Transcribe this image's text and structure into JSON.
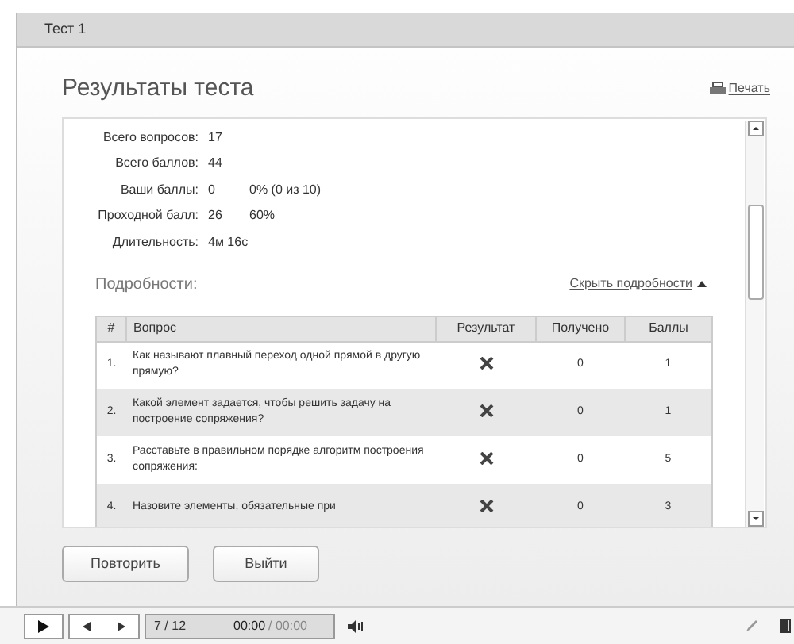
{
  "window": {
    "title": "Тест 1"
  },
  "header": {
    "title": "Результаты теста",
    "print_link": "Печать"
  },
  "summary": [
    {
      "label": "Всего вопросов:",
      "value": "17"
    },
    {
      "label": "Всего баллов:",
      "value": "44"
    },
    {
      "label": "Ваши баллы:",
      "value": "0",
      "extra": "0% (0 из 10)"
    },
    {
      "label": "Проходной балл:",
      "value": "26",
      "extra": "60%"
    },
    {
      "label": "Длительность:",
      "value": "4м 16с"
    }
  ],
  "details": {
    "title": "Подробности:",
    "toggle_link": "Скрыть подробности",
    "expanded": true
  },
  "table": {
    "columns": [
      "#",
      "Вопрос",
      "Результат",
      "Получено",
      "Баллы"
    ],
    "rows": [
      {
        "number": "1.",
        "question": "Как называют плавный переход одной прямой в другую прямую?",
        "correct": false,
        "received": "0",
        "points": "1"
      },
      {
        "number": "2.",
        "question": "Какой элемент задается, чтобы решить задачу на построение сопряжения?",
        "correct": false,
        "received": "0",
        "points": "1"
      },
      {
        "number": "3.",
        "question": "Расставьте в правильном порядке  алгоритм построения сопряжения:",
        "correct": false,
        "received": "0",
        "points": "5"
      },
      {
        "number": "4.",
        "question": "Назовите элементы,  обязательные при",
        "correct": false,
        "received": "0",
        "points": "3"
      }
    ]
  },
  "buttons": [
    "Повторить",
    "Выйти"
  ],
  "player": {
    "slide_counter": "7 / 12",
    "time": "00:00",
    "duration": "/ 00:00"
  }
}
